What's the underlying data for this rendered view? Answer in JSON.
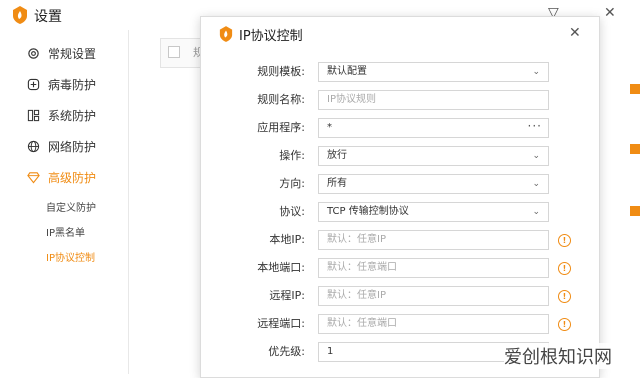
{
  "window": {
    "title": "设置",
    "minimize_glyph": "▽",
    "close_glyph": "✕"
  },
  "sidebar": {
    "items": [
      {
        "label": "常规设置",
        "icon": "gear-icon"
      },
      {
        "label": "病毒防护",
        "icon": "plus-shield-icon"
      },
      {
        "label": "系统防护",
        "icon": "windows-icon"
      },
      {
        "label": "网络防护",
        "icon": "globe-icon"
      },
      {
        "label": "高级防护",
        "icon": "diamond-icon"
      }
    ],
    "subitems": [
      "自定义防护",
      "IP黑名单",
      "IP协议控制"
    ]
  },
  "background": {
    "column_header": "规"
  },
  "dialog": {
    "title": "IP协议控制",
    "close_glyph": "✕",
    "fields": {
      "template": {
        "label": "规则模板:",
        "value": "默认配置"
      },
      "name": {
        "label": "规则名称:",
        "placeholder": "IP协议规则"
      },
      "program": {
        "label": "应用程序:",
        "value": "*",
        "more": "···"
      },
      "action": {
        "label": "操作:",
        "value": "放行"
      },
      "direction": {
        "label": "方向:",
        "value": "所有"
      },
      "protocol": {
        "label": "协议:",
        "value": "TCP 传输控制协议"
      },
      "local_ip": {
        "label": "本地IP:",
        "placeholder": "默认：任意IP"
      },
      "local_port": {
        "label": "本地端口:",
        "placeholder": "默认：任意端口"
      },
      "remote_ip": {
        "label": "远程IP:",
        "placeholder": "默认：任意IP"
      },
      "remote_port": {
        "label": "远程端口:",
        "placeholder": "默认：任意端口"
      },
      "priority": {
        "label": "优先级:",
        "value": "1"
      }
    },
    "warn_glyph": "!"
  },
  "watermark": "爱创根知识网",
  "colors": {
    "accent": "#f08c14",
    "border": "#d6d6d6",
    "text": "#333333"
  }
}
